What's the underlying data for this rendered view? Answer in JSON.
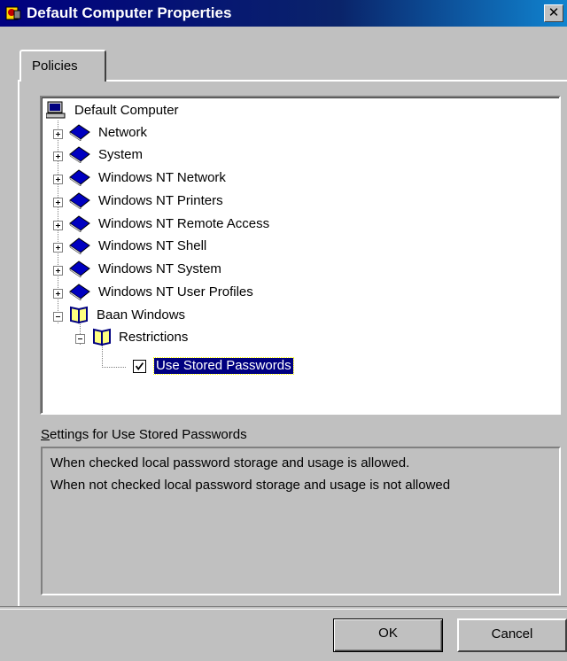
{
  "window": {
    "title": "Default Computer Properties",
    "close_label": "✕"
  },
  "tabs": [
    {
      "label": "Policies",
      "selected": true
    }
  ],
  "tree": {
    "root": {
      "label": "Default Computer",
      "icon": "computer-icon"
    },
    "categories": [
      {
        "label": "Network",
        "icon": "book-closed-icon",
        "expanded": false
      },
      {
        "label": "System",
        "icon": "book-closed-icon",
        "expanded": false
      },
      {
        "label": "Windows NT Network",
        "icon": "book-closed-icon",
        "expanded": false
      },
      {
        "label": "Windows NT Printers",
        "icon": "book-closed-icon",
        "expanded": false
      },
      {
        "label": "Windows NT Remote Access",
        "icon": "book-closed-icon",
        "expanded": false
      },
      {
        "label": "Windows NT Shell",
        "icon": "book-closed-icon",
        "expanded": false
      },
      {
        "label": "Windows NT System",
        "icon": "book-closed-icon",
        "expanded": false
      },
      {
        "label": "Windows NT User Profiles",
        "icon": "book-closed-icon",
        "expanded": false
      },
      {
        "label": "Baan Windows",
        "icon": "book-open-icon",
        "expanded": true
      }
    ],
    "subcategory": {
      "label": "Restrictions",
      "icon": "book-open-icon",
      "expanded": true
    },
    "policy": {
      "label": "Use Stored Passwords",
      "checked": true,
      "selected": true
    }
  },
  "settings": {
    "label": "Settings for Use Stored Passwords",
    "lines": [
      "When checked local password storage and usage is allowed.",
      "When not checked local password storage and usage is not allowed"
    ]
  },
  "buttons": {
    "ok": "OK",
    "cancel": "Cancel"
  },
  "colors": {
    "titlebar": "#000080",
    "face": "#c0c0c0",
    "selection": "#000080",
    "book": "#0000c0"
  }
}
